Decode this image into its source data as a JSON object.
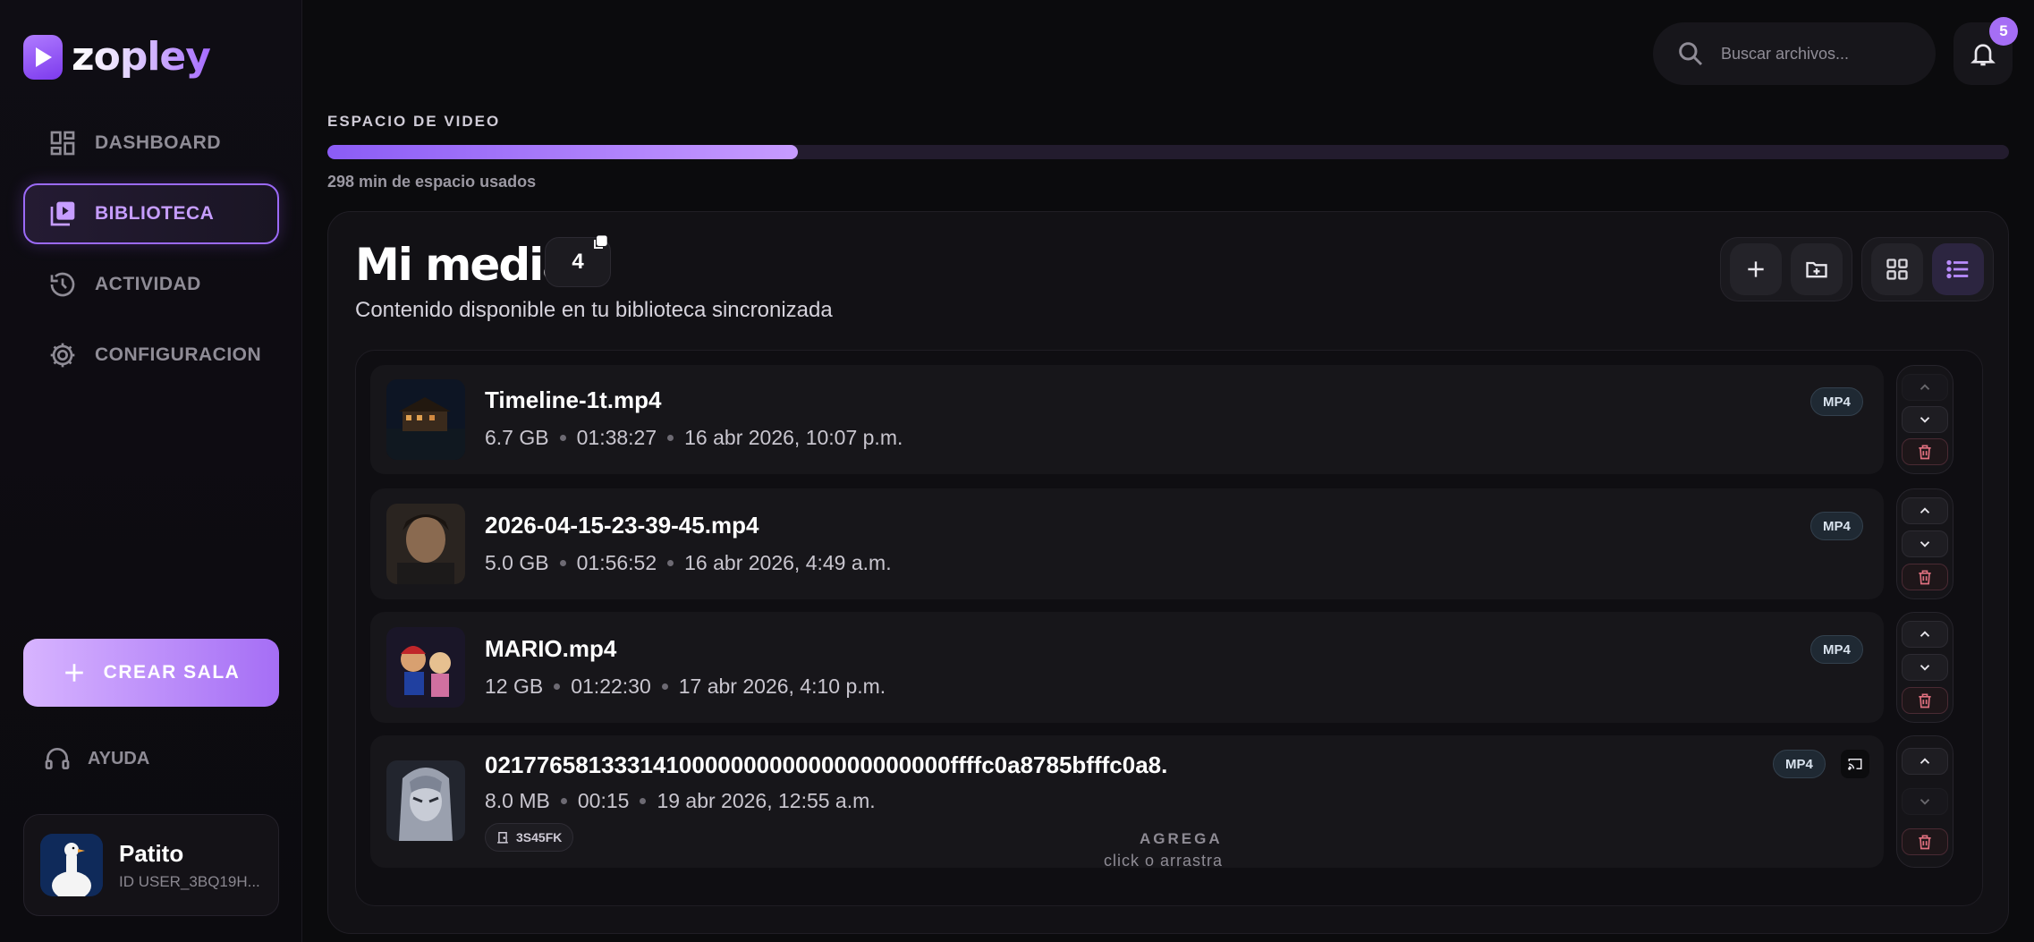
{
  "brand": {
    "name": "zopley"
  },
  "nav": {
    "items": [
      {
        "label": "DASHBOARD",
        "icon": "dashboard-icon",
        "active": false
      },
      {
        "label": "BIBLIOTECA",
        "icon": "library-icon",
        "active": true
      },
      {
        "label": "ACTIVIDAD",
        "icon": "history-icon",
        "active": false
      },
      {
        "label": "CONFIGURACION",
        "icon": "gear-icon",
        "active": false
      }
    ],
    "create_label": "CREAR SALA",
    "help_label": "AYUDA"
  },
  "profile": {
    "name": "Patito",
    "id": "ID USER_3BQ19H..."
  },
  "topbar": {
    "search_placeholder": "Buscar archivos...",
    "notifications": "5"
  },
  "storage": {
    "title": "ESPACIO DE VIDEO",
    "used_text": "298 min de espacio usados",
    "used_fraction": 0.28
  },
  "library": {
    "title": "Mi media",
    "count": "4",
    "subtitle": "Contenido disponible en tu biblioteca sincronizada",
    "items": [
      {
        "name": "Timeline-1t.mp4",
        "size": "6.7 GB",
        "duration": "01:38:27",
        "date": "16 abr 2026, 10:07 p.m.",
        "format": "MP4"
      },
      {
        "name": "2026-04-15-23-39-45.mp4",
        "size": "5.0 GB",
        "duration": "01:56:52",
        "date": "16 abr 2026, 4:49 a.m.",
        "format": "MP4"
      },
      {
        "name": "MARIO.mp4",
        "size": "12 GB",
        "duration": "01:22:30",
        "date": "17 abr 2026, 4:10 p.m.",
        "format": "MP4"
      },
      {
        "name": "021776581333141000000000000000000000ffffc0a8785bfffc0a8.",
        "size": "8.0 MB",
        "duration": "00:15",
        "date": "19 abr 2026, 12:55 a.m.",
        "format": "MP4",
        "tag": "3S45FK"
      }
    ],
    "drop_title": "AGREGA",
    "drop_sub": "click o arrastra"
  },
  "colors": {
    "accent": "#a56ef5",
    "accent_light": "#c69dff",
    "background": "#0b0b0d",
    "panel": "#121115",
    "danger": "#e0707f"
  }
}
